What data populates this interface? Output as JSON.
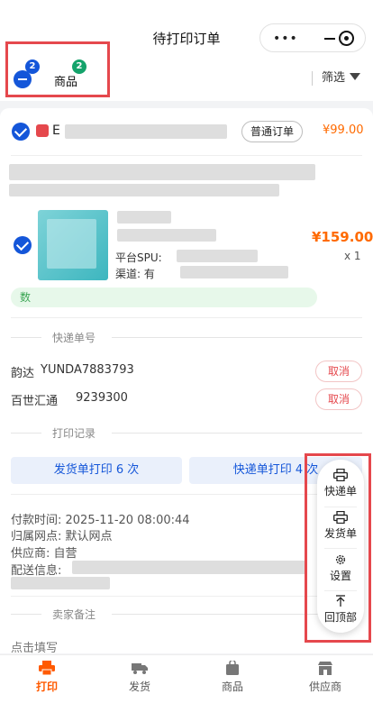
{
  "nav": {
    "title": "待打印订单"
  },
  "filterbar": {
    "goods_label": "商品",
    "minus_badge": "2",
    "goods_badge": "2",
    "filter_label": "筛选"
  },
  "order": {
    "id_prefix": "E",
    "type_pill": "普通订单",
    "price_top": "¥99.00",
    "product": {
      "line_platform": "平台SPU:",
      "line_channel": "渠道: 有",
      "price": "¥159.00",
      "qty": "x 1"
    },
    "promo": "数"
  },
  "express": {
    "section_title": "快递单号",
    "rows": [
      {
        "carrier": "韵达",
        "number": "YUNDA7883793",
        "action": "取消"
      },
      {
        "carrier": "百世汇通",
        "number": "9239300",
        "action": "取消"
      }
    ]
  },
  "print_log": {
    "section_title": "打印记录",
    "delivery_btn": "发货单打印 6 次",
    "express_btn": "快递单打印 4 次"
  },
  "info": {
    "paid_time": "付款时间: 2025-11-20 08:00:44",
    "branch": "归属网点: 默认网点",
    "supplier": "供应商: 自营",
    "shipping": "配送信息:"
  },
  "remark": {
    "section_title": "卖家备注",
    "placeholder": "点击填写"
  },
  "float_menu": [
    {
      "label": "快递单",
      "icon": "printer-icon"
    },
    {
      "label": "发货单",
      "icon": "printer-icon"
    },
    {
      "label": "设置",
      "icon": "gear-icon"
    },
    {
      "label": "回顶部",
      "icon": "arrow-up-icon"
    }
  ],
  "tabbar": [
    {
      "label": "打印",
      "active": true,
      "icon": "printer-icon"
    },
    {
      "label": "发货",
      "active": false,
      "icon": "truck-icon"
    },
    {
      "label": "商品",
      "active": false,
      "icon": "bag-icon"
    },
    {
      "label": "供应商",
      "active": false,
      "icon": "store-icon"
    }
  ],
  "colors": {
    "accent": "#1456d9",
    "price": "#ff6a00",
    "danger": "#e5484d",
    "highlight_box": "#e5484d"
  }
}
